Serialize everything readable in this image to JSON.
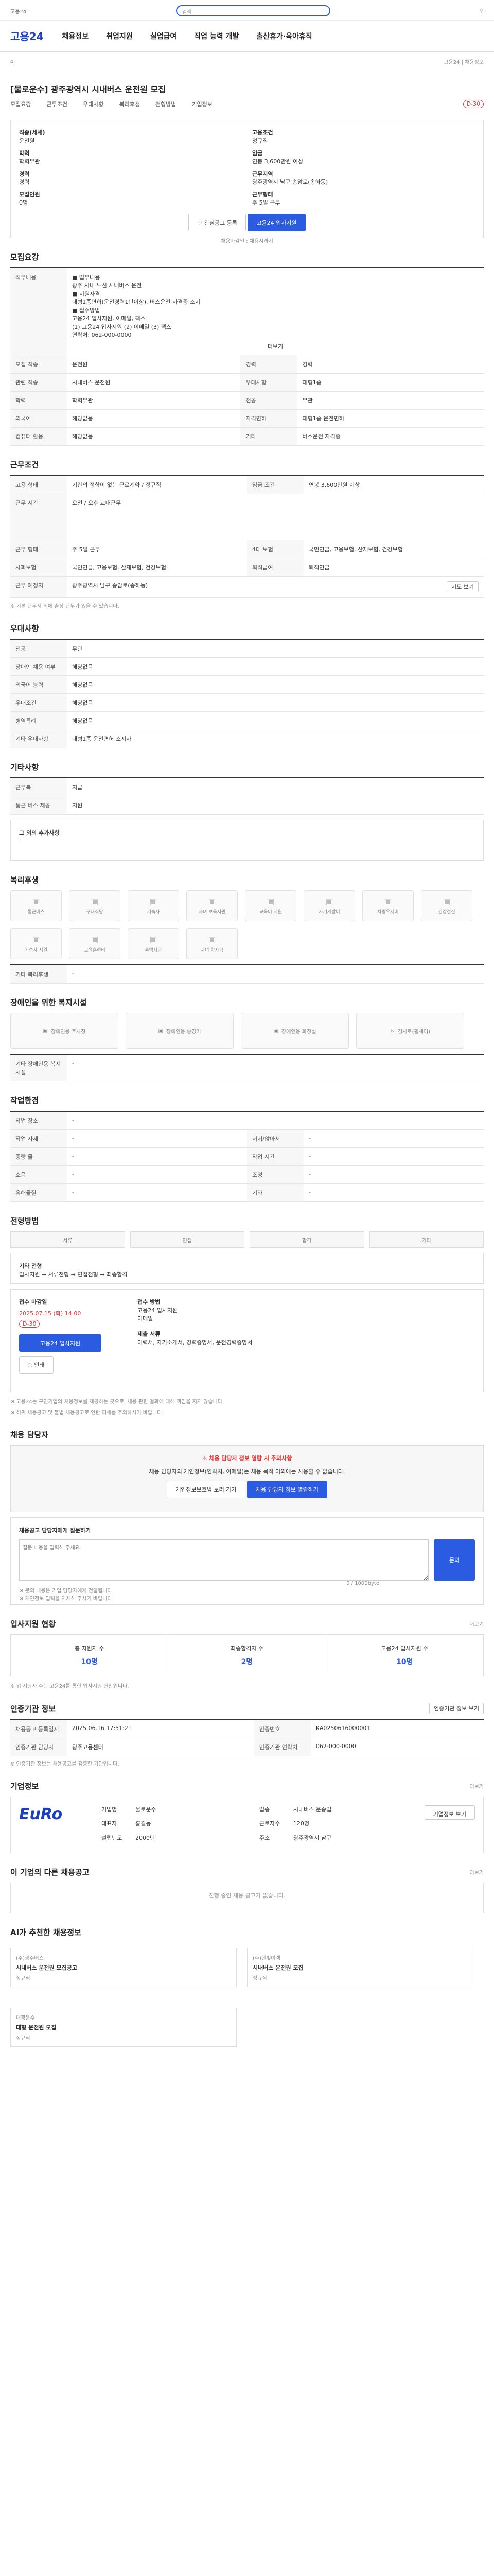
{
  "header": {
    "logo": "고용24",
    "menu": [
      "채용정보",
      "취업지원",
      "실업급여",
      "직업 능력 개발",
      "출산휴가·육아휴직"
    ],
    "search_placeholder": "검색",
    "sub_left": "채용정보",
    "sub_right": "고용24 | 채용정보"
  },
  "job": {
    "title": "[물로운수] 광주광역시 시내버스 운전원 모집",
    "badge": "D-30",
    "tabs": [
      "모집요강",
      "근무조건",
      "우대사항",
      "복리후생",
      "전형방법",
      "기업정보"
    ],
    "summary": [
      [
        "직종(세세)",
        "운전원",
        "고용조건",
        "정규직"
      ],
      [
        "학력",
        "학력무관",
        "임금",
        "연봉 3,600만원 이상"
      ],
      [
        "경력",
        "경력",
        "근무지역",
        "광주광역시 남구 송암로(송하동)"
      ],
      [
        "모집인원",
        "0명",
        "근무형태",
        "주 5일 근무"
      ]
    ],
    "recruit_label": "채용마감일",
    "recruit_value": "채용시까지",
    "scrap": "관심공고 등록",
    "apply": "고용24 입사지원"
  },
  "s1": {
    "title": "모집요강",
    "duties_label": "직무내용",
    "duties": [
      "■ 업무내용",
      "광주 시내 노선 시내버스 운전",
      "■ 지원자격",
      "대형1종면허(운전경력1년이상), 버스운전 자격증 소지",
      "■ 접수방법",
      "고용24 입사지원, 이메일, 팩스",
      "(1) 고용24 입사지원 (2) 이메일 (3) 팩스",
      "연락처: 062-000-0000"
    ],
    "rows": [
      [
        "모집 직종",
        "운전원",
        "경력",
        "경력"
      ],
      [
        "관련 직종",
        "시내버스 운전원",
        "우대사항",
        "대형1종"
      ],
      [
        "학력",
        "학력무관",
        "전공",
        "무관"
      ],
      [
        "외국어",
        "해당없음",
        "자격면허",
        "대형1종 운전면허"
      ],
      [
        "컴퓨터 활용",
        "해당없음",
        "기타",
        "버스운전 자격증"
      ]
    ],
    "more": "더보기"
  },
  "s2": {
    "title": "근무조건",
    "rows": [
      [
        "고용 형태",
        "기간의 정함이 없는 근로계약 / 정규직",
        "임금 조건",
        "연봉 3,600만원 이상"
      ],
      [
        "근무 시간",
        "오전 / 오후 교대근무",
        "",
        ""
      ],
      [
        "근무 형태",
        "주 5일 근무",
        "4대 보험",
        "국민연금, 고용보험, 산재보험, 건강보험"
      ],
      [
        "사회보험",
        "국민연금, 고용보험, 산재보험, 건강보험",
        "퇴직급여",
        "퇴직연금"
      ],
      [
        "근무 예정지",
        "광주광역시 남구 송암로(송하동)",
        "",
        ""
      ]
    ],
    "map_btn": "지도 보기",
    "note": "※ 기본 근무지 외에 출장 근무가 있을 수 있습니다."
  },
  "s3": {
    "title": "우대사항",
    "rows": [
      [
        "전공",
        "무관"
      ],
      [
        "장애인 채용 여부",
        "해당없음"
      ],
      [
        "외국어 능력",
        "해당없음"
      ],
      [
        "우대조건",
        "해당없음"
      ],
      [
        "병역특례",
        "해당없음"
      ],
      [
        "기타 우대사항",
        "대형1종 운전면허 소지자"
      ]
    ]
  },
  "s4": {
    "title": "기타사항",
    "rows": [
      [
        "근무복",
        "지급"
      ],
      [
        "통근 버스 제공",
        "지원"
      ]
    ],
    "extra_label": "그 외의 추가사항",
    "extra": "·"
  },
  "welfare": {
    "title": "복리후생",
    "items": [
      "통근버스",
      "구내식당",
      "기숙사",
      "자녀 보육지원",
      "교육비 지원",
      "자기계발비",
      "차량유지비",
      "건강검진",
      "기숙사 지원",
      "교육훈련비",
      "주택자금",
      "자녀 학자금"
    ],
    "other_label": "기타 복리후생",
    "other": "-"
  },
  "disabled": {
    "title": "장애인을 위한 복지시설",
    "items": [
      "장애인용 주차장",
      "장애인용 승강기",
      "장애인용 화장실",
      "경사로(휠체어)"
    ],
    "other_label": "기타 장애인용 복지시설",
    "other": "-"
  },
  "work": {
    "title": "작업환경",
    "rows": [
      [
        "작업 장소",
        "-",
        "",
        ""
      ],
      [
        "작업 자세",
        "-",
        "서서/앉아서",
        "-"
      ],
      [
        "중량 물",
        "-",
        "작업 시간",
        "-"
      ],
      [
        "소음",
        "-",
        "조명",
        "-"
      ],
      [
        "유해물질",
        "-",
        "기타",
        "-"
      ]
    ]
  },
  "process": {
    "title": "전형방법",
    "steps": [
      "서류",
      "면접",
      "합격",
      "기타"
    ],
    "etc_label": "기타 전형",
    "etc": "입사지원 → 서류전형 → 면접전형 → 최종합격"
  },
  "apply_info": {
    "start_label": "접수 마감일",
    "start": "2025.07.15 (화) 14:00",
    "dday": "D-30",
    "method_label": "접수 방법",
    "method": [
      "고용24 입사지원",
      "이메일"
    ],
    "docs_label": "제출 서류",
    "docs": "이력서, 자기소개서, 경력증명서, 운전경력증명서",
    "apply_btn": "고용24 입사지원",
    "print_btn": "인쇄"
  },
  "notice": [
    "※ 고용24는 구인기업의 채용정보를 제공하는 곳으로, 채용 관련 결과에 대해 책임을 지지 않습니다.",
    "※ 허위 채용공고 및 불법 채용공고로 인한 피해를 주의하시기 바랍니다."
  ],
  "contact": {
    "title": "채용 담당자",
    "alert": "채용 담당자 정보 열람 시 주의사항",
    "desc": "채용 담당자의 개인정보(연락처, 이메일)는 채용 목적 이외에는 사용할 수 없습니다.",
    "btn1": "개인정보보호법 보러 가기",
    "btn2": "채용 담당자 정보 열람하기"
  },
  "qna": {
    "title": "채용공고 담당자에게 질문하기",
    "placeholder": "질문 내용을 입력해 주세요.",
    "btn": "문의",
    "count": "0 / 1000byte",
    "notes": [
      "※ 문의 내용은 기업 담당자에게 전달됩니다.",
      "※ 개인정보 입력을 자제해 주시기 바랍니다."
    ]
  },
  "status": {
    "title": "입사지원 현황",
    "more": "더보기",
    "items": [
      [
        "총 지원자 수",
        "10명"
      ],
      [
        "최종합격자 수",
        "2명"
      ],
      [
        "고용24 입사지원 수",
        "10명"
      ]
    ],
    "note": "※ 위 지원자 수는 고용24를 통한 입사지원 현황입니다."
  },
  "info": {
    "title": "인증기관 정보",
    "btn": "인증기관 정보 보기",
    "rows": [
      [
        "채용공고 등록일시",
        "2025.06.16 17:51:21",
        "인증번호",
        "KA0250616000001"
      ],
      [
        "인증기관 담당자",
        "광주고용센터",
        "인증기관 연락처",
        "062-000-0000"
      ]
    ],
    "note": "※ 인증기관 정보는 채용공고를 검증한 기관입니다."
  },
  "company": {
    "title": "기업정보",
    "more": "더보기",
    "logo": "EuRo",
    "rows": [
      [
        "기업명",
        "물로운수",
        "업종",
        "시내버스 운송업"
      ],
      [
        "대표자",
        "홍길동",
        "근로자수",
        "120명"
      ],
      [
        "설립년도",
        "2000년",
        "주소",
        "광주광역시 남구"
      ]
    ],
    "btn": "기업정보 보기"
  },
  "closed": {
    "title": "이 기업의 다른 채용공고",
    "note": "진행 중인 채용 공고가 없습니다.",
    "more": "더보기"
  },
  "reco": {
    "title": "AI가 추천한 채용정보",
    "items": [
      {
        "company": "(주)광주버스",
        "title": "시내버스 운전원 모집공고",
        "tag": "정규직"
      },
      {
        "company": "(주)한빛여객",
        "title": "시내버스 운전원 모집",
        "tag": "정규직"
      },
      {
        "company": "대광운수",
        "title": "대형 운전원 모집",
        "tag": "정규직"
      }
    ]
  }
}
